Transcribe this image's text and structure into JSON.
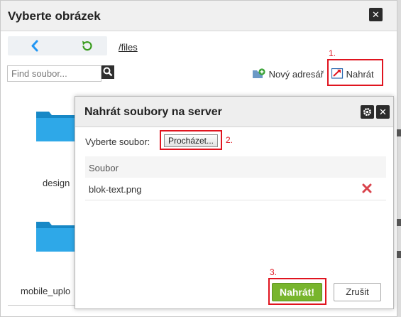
{
  "file_browser": {
    "title": "Vyberte obrázek",
    "path": "/files",
    "search": {
      "placeholder": "Find soubor..."
    },
    "toolbar": {
      "new_folder_label": "Nový adresář",
      "upload_label": "Nahrát"
    },
    "folders": [
      {
        "label": "design"
      },
      {
        "label": "mobile_uplo"
      }
    ]
  },
  "upload_dialog": {
    "title": "Nahrát soubory na server",
    "choose_label": "Vyberte soubor:",
    "browse_label": "Procházet...",
    "table_header": "Soubor",
    "files": [
      {
        "name": "blok-text.png"
      }
    ],
    "submit_label": "Nahrát!",
    "cancel_label": "Zrušit"
  },
  "steps": {
    "step1": "1.",
    "step2": "2.",
    "step3": "3."
  },
  "colors": {
    "highlight": "#e0141f",
    "submit": "#78b52d",
    "folder": "#1f9fe0",
    "back_arrow": "#2196f3",
    "refresh": "#3a9c1f",
    "remove": "#d9434c"
  }
}
